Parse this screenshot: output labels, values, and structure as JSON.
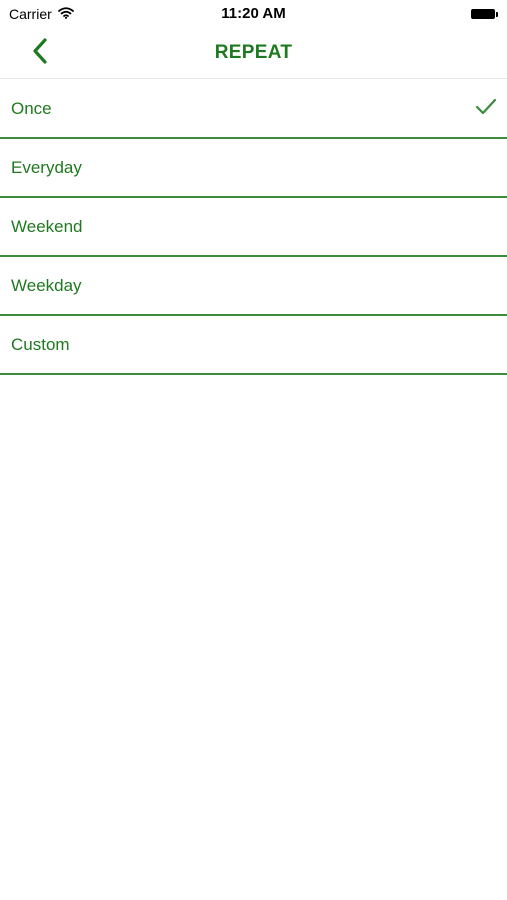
{
  "status_bar": {
    "carrier": "Carrier",
    "time": "11:20 AM"
  },
  "nav": {
    "title": "REPEAT",
    "back_icon": "chevron-left-icon"
  },
  "colors": {
    "accent": "#1f7a1f",
    "divider": "#3c8a3c"
  },
  "options": [
    {
      "label": "Once",
      "selected": true
    },
    {
      "label": "Everyday",
      "selected": false
    },
    {
      "label": "Weekend",
      "selected": false
    },
    {
      "label": "Weekday",
      "selected": false
    },
    {
      "label": "Custom",
      "selected": false
    }
  ]
}
